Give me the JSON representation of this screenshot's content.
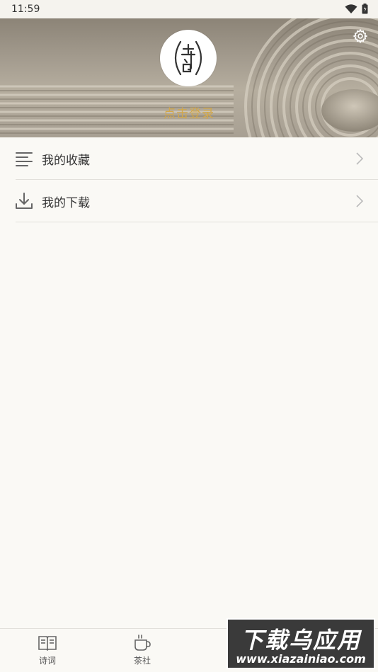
{
  "status_bar": {
    "time": "11:59"
  },
  "header": {
    "login_text": "点击登录",
    "avatar_logo_text": "詩"
  },
  "menu": {
    "items": [
      {
        "label": "我的收藏",
        "icon": "list-icon"
      },
      {
        "label": "我的下载",
        "icon": "download-icon"
      }
    ]
  },
  "tab_bar": {
    "tabs": [
      {
        "label": "诗词",
        "icon": "book-icon"
      },
      {
        "label": "茶社",
        "icon": "tea-cup-icon"
      }
    ]
  },
  "watermark": {
    "title": "下载乌应用",
    "url": "www.xiazainiao.com"
  },
  "colors": {
    "accent_gold": "#d3a84a",
    "background": "#faf9f5",
    "divider": "#e2e0db"
  }
}
